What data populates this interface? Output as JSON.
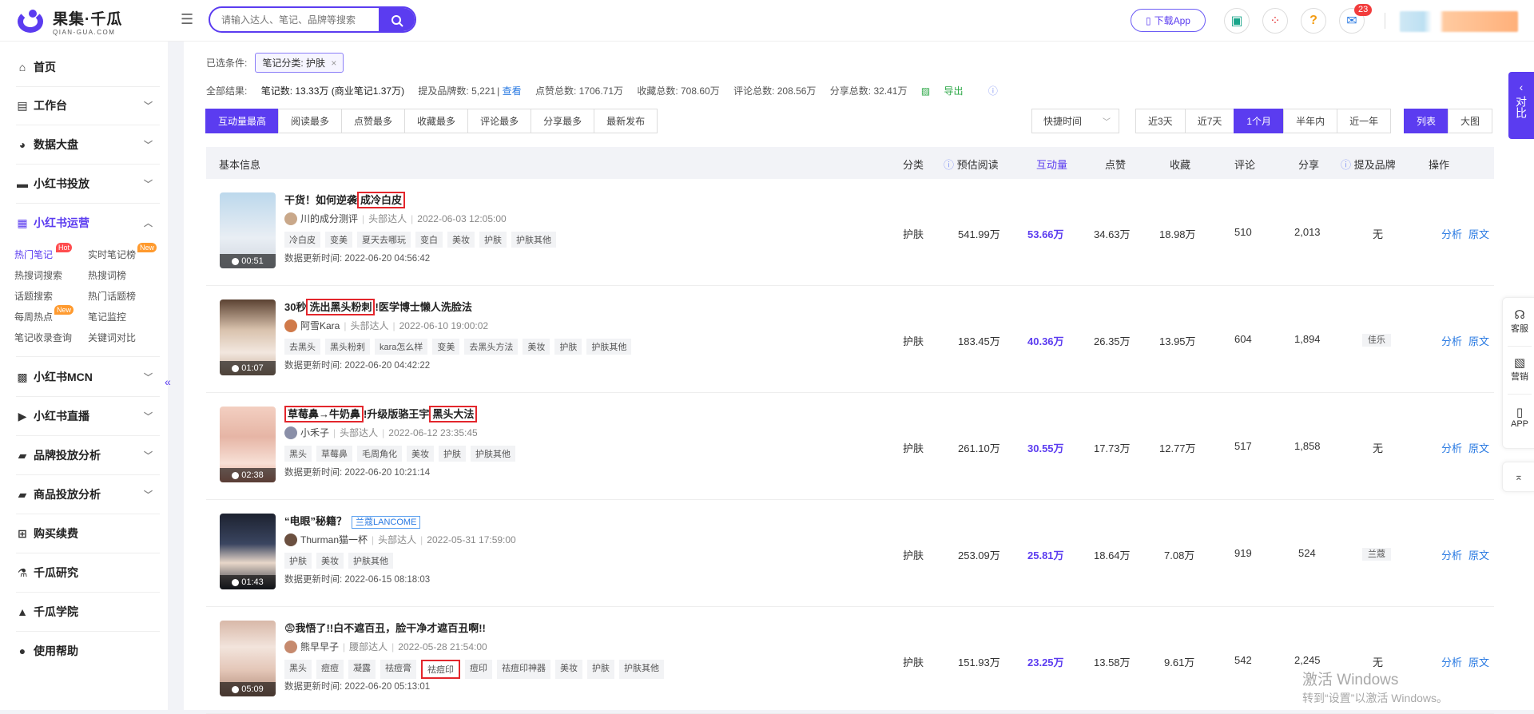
{
  "brand": {
    "cn": "果集·千瓜",
    "en": "QIAN-GUA.COM"
  },
  "search": {
    "placeholder": "请输入达人、笔记、品牌等搜索"
  },
  "topbar": {
    "download_app": "下载App",
    "mail_badge": "23"
  },
  "sidebar": {
    "items": [
      {
        "label": "首页",
        "icon": "home-icon"
      },
      {
        "label": "工作台",
        "icon": "workbench-icon"
      },
      {
        "label": "数据大盘",
        "icon": "pie-chart-icon"
      },
      {
        "label": "小红书投放",
        "icon": "folder-icon"
      },
      {
        "label": "小红书运营",
        "icon": "chart-line-icon"
      },
      {
        "label": "小红书MCN",
        "icon": "grid-icon"
      },
      {
        "label": "小红书直播",
        "icon": "video-icon"
      },
      {
        "label": "品牌投放分析",
        "icon": "bag-icon"
      },
      {
        "label": "商品投放分析",
        "icon": "shopping-bag-icon"
      },
      {
        "label": "购买续费",
        "icon": "cart-icon"
      },
      {
        "label": "千瓜研究",
        "icon": "flask-icon"
      },
      {
        "label": "千瓜学院",
        "icon": "graduation-cap-icon"
      },
      {
        "label": "使用帮助",
        "icon": "help-icon"
      }
    ],
    "sub_items": [
      "热门笔记",
      "实时笔记榜",
      "热搜词搜索",
      "热搜词榜",
      "话题搜索",
      "热门话题榜",
      "每周热点",
      "笔记监控",
      "笔记收录查询",
      "关键词对比"
    ],
    "hot": "Hot",
    "new": "New"
  },
  "filters": {
    "label": "已选条件:",
    "chip": "笔记分类: 护肤",
    "chip_close": "×"
  },
  "stats": {
    "all_results": "全部结果:",
    "notes": "笔记数: 13.33万 (商业笔记1.37万)",
    "brands": "提及品牌数: 5,221",
    "view": "查看",
    "likes": "点赞总数: 1706.71万",
    "collects": "收藏总数: 708.60万",
    "comments": "评论总数: 208.56万",
    "shares": "分享总数: 32.41万",
    "export": "导出"
  },
  "sort_tabs": [
    "互动量最高",
    "阅读最多",
    "点赞最多",
    "收藏最多",
    "评论最多",
    "分享最多",
    "最新发布"
  ],
  "time_select": "快捷时间",
  "time_tabs": [
    "近3天",
    "近7天",
    "1个月",
    "半年内",
    "近一年"
  ],
  "view_tabs": [
    "列表",
    "大图"
  ],
  "table": {
    "headers": {
      "basic": "基本信息",
      "category": "分类",
      "est_read": "预估阅读",
      "interaction": "互动量",
      "likes": "点赞",
      "collects": "收藏",
      "comments": "评论",
      "shares": "分享",
      "brands": "提及品牌",
      "ops": "操作"
    },
    "update_prefix": "数据更新时间:",
    "op_analyze": "分析",
    "op_source": "原文",
    "rows": [
      {
        "title_pre": "干货！如何逆袭",
        "title_hl": "成冷白皮",
        "title_post": "",
        "duration": "00:51",
        "author": "川的成分测评",
        "level": "头部达人",
        "time": "2022-06-03 12:05:00",
        "tags": [
          "冷白皮",
          "变美",
          "夏天去哪玩",
          "变白",
          "美妆",
          "护肤",
          "护肤其他"
        ],
        "updated": "2022-06-20 04:56:42",
        "category": "护肤",
        "est_read": "541.99万",
        "interaction": "53.66万",
        "likes": "34.63万",
        "collects": "18.98万",
        "comments": "510",
        "shares": "2,013",
        "brand": "无"
      },
      {
        "title_pre": "30秒",
        "title_hl": "洗出黑头粉刺",
        "title_post": "!医学博士懒人洗脸法",
        "duration": "01:07",
        "author": "阿雪Kara",
        "level": "头部达人",
        "time": "2022-06-10 19:00:02",
        "tags": [
          "去黑头",
          "黑头粉刺",
          "kara怎么样",
          "变美",
          "去黑头方法",
          "美妆",
          "护肤",
          "护肤其他"
        ],
        "updated": "2022-06-20 04:42:22",
        "category": "护肤",
        "est_read": "183.45万",
        "interaction": "40.36万",
        "likes": "26.35万",
        "collects": "13.95万",
        "comments": "604",
        "shares": "1,894",
        "brand": "佳乐"
      },
      {
        "title_pre": "",
        "title_hl": "草莓鼻→牛奶鼻",
        "title_post": "!升级版骆王宇",
        "title_hl2": "黑头大法",
        "duration": "02:38",
        "author": "小禾子",
        "level": "头部达人",
        "time": "2022-06-12 23:35:45",
        "tags": [
          "黑头",
          "草莓鼻",
          "毛周角化",
          "美妆",
          "护肤",
          "护肤其他"
        ],
        "updated": "2022-06-20 10:21:14",
        "category": "护肤",
        "est_read": "261.10万",
        "interaction": "30.55万",
        "likes": "17.73万",
        "collects": "12.77万",
        "comments": "517",
        "shares": "1,858",
        "brand": "无"
      },
      {
        "title_pre": "“电眼”秘籍？",
        "title_hl": "",
        "title_post": "",
        "brand_tag": "兰蔻LANCOME",
        "duration": "01:43",
        "author": "Thurman猫一杯",
        "level": "头部达人",
        "time": "2022-05-31 17:59:00",
        "tags": [
          "护肤",
          "美妆",
          "护肤其他"
        ],
        "updated": "2022-06-15 08:18:03",
        "category": "护肤",
        "est_read": "253.09万",
        "interaction": "25.81万",
        "likes": "18.64万",
        "collects": "7.08万",
        "comments": "919",
        "shares": "524",
        "brand": "兰蔻"
      },
      {
        "title_pre": "😨我悟了!!白不遮百丑，脸干净才遮百丑啊!!",
        "title_hl": "",
        "title_post": "",
        "duration": "05:09",
        "author": "熊早早子",
        "level": "腰部达人",
        "time": "2022-05-28 21:54:00",
        "tags": [
          "黑头",
          "痘痘",
          "凝露",
          "祛痘膏",
          "祛痘印",
          "痘印",
          "祛痘印神器",
          "美妆",
          "护肤",
          "护肤其他"
        ],
        "updated": "2022-06-20 05:13:01",
        "category": "护肤",
        "est_read": "151.93万",
        "interaction": "23.25万",
        "likes": "13.58万",
        "collects": "9.61万",
        "comments": "542",
        "shares": "2,245",
        "brand": "无"
      }
    ]
  },
  "right_float": {
    "compare": "对比"
  },
  "right_panel": {
    "service": "客服",
    "marketing": "营销",
    "app": "APP"
  },
  "watermark": {
    "line1": "激活 Windows",
    "line2": "转到“设置”以激活 Windows。"
  }
}
